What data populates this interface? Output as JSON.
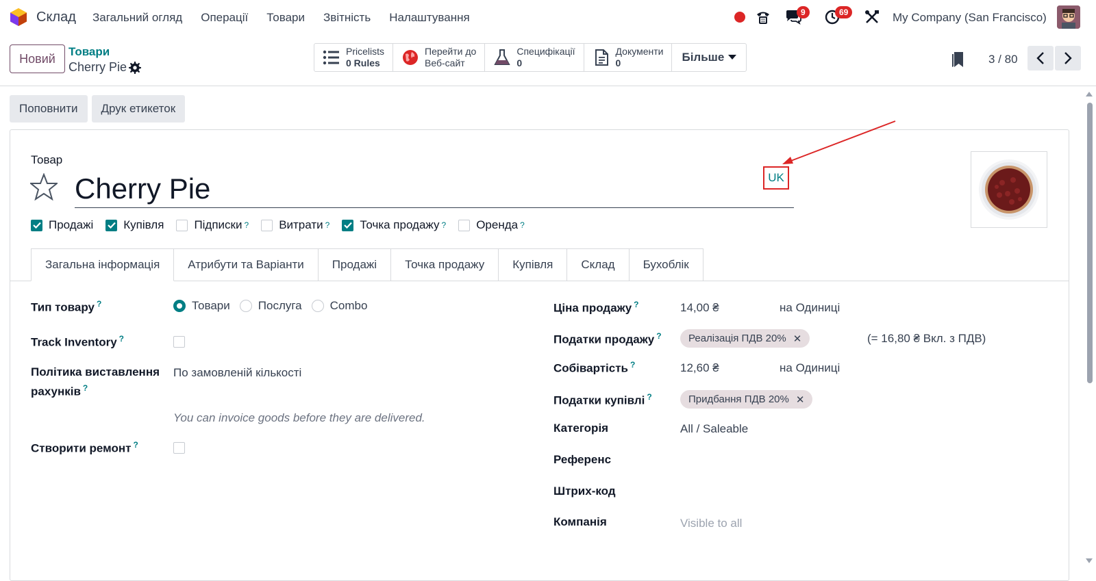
{
  "nav": {
    "app_name": "Склад",
    "menu": [
      "Загальний огляд",
      "Операції",
      "Товари",
      "Звітність",
      "Налаштування"
    ],
    "messages_badge": "9",
    "activities_badge": "69",
    "company": "My Company (San Francisco)"
  },
  "control": {
    "new_label": "Новий",
    "breadcrumb_parent": "Товари",
    "breadcrumb_current": "Cherry Pie",
    "smart_buttons": [
      {
        "line1": "Pricelists",
        "line2": "0  Rules",
        "icon": "list-icon"
      },
      {
        "line1": "Перейти до",
        "line2": "Веб-сайт",
        "icon": "globe-icon"
      },
      {
        "line1": "Специфікації",
        "line2": "0",
        "icon": "flask-icon"
      },
      {
        "line1": "Документи",
        "line2": "0",
        "icon": "document-icon"
      }
    ],
    "more_label": "Більше",
    "pager": "3 / 80"
  },
  "actions": {
    "replenish": "Поповнити",
    "print_labels": "Друк етикеток"
  },
  "form": {
    "product_label": "Товар",
    "name": "Cherry Pie",
    "lang": "UK",
    "checkboxes": [
      {
        "label": "Продажі",
        "checked": true,
        "help": false
      },
      {
        "label": "Купівля",
        "checked": true,
        "help": false
      },
      {
        "label": "Підписки",
        "checked": false,
        "help": true
      },
      {
        "label": "Витрати",
        "checked": false,
        "help": true
      },
      {
        "label": "Точка продажу",
        "checked": true,
        "help": true
      },
      {
        "label": "Оренда",
        "checked": false,
        "help": true
      }
    ],
    "tabs": [
      "Загальна інформація",
      "Атрибути та Варіанти",
      "Продажі",
      "Точка продажу",
      "Купівля",
      "Склад",
      "Бухоблік"
    ],
    "left": {
      "product_type_label": "Тип товару",
      "product_type_options": [
        "Товари",
        "Послуга",
        "Combo"
      ],
      "track_inventory_label": "Track Inventory",
      "invoicing_policy_label_1": "Політика виставлення",
      "invoicing_policy_label_2": "рахунків",
      "invoicing_policy_value": "По замовленій кількості",
      "invoicing_hint": "You can invoice goods before they are delivered.",
      "create_repair_label": "Створити ремонт"
    },
    "right": {
      "sale_price_label": "Ціна продажу",
      "sale_price_value": "14,00 ₴",
      "sale_price_unit": "на Одиниці",
      "sale_taxes_label": "Податки продажу",
      "sale_tax_tag": "Реалізація ПДВ 20%",
      "sale_tax_incl": "(= 16,80 ₴ Вкл. з ПДВ)",
      "cost_label": "Собівартість",
      "cost_value": "12,60 ₴",
      "cost_unit": "на Одиниці",
      "purchase_taxes_label": "Податки купівлі",
      "purchase_tax_tag": "Придбання ПДВ 20%",
      "category_label": "Категорія",
      "category_value": "All / Saleable",
      "reference_label": "Референс",
      "barcode_label": "Штрих-код",
      "company_label": "Компанія",
      "company_placeholder": "Visible to all"
    }
  },
  "colors": {
    "brand": "#714b67",
    "accent": "#017e84",
    "annotation": "#dc2626"
  }
}
